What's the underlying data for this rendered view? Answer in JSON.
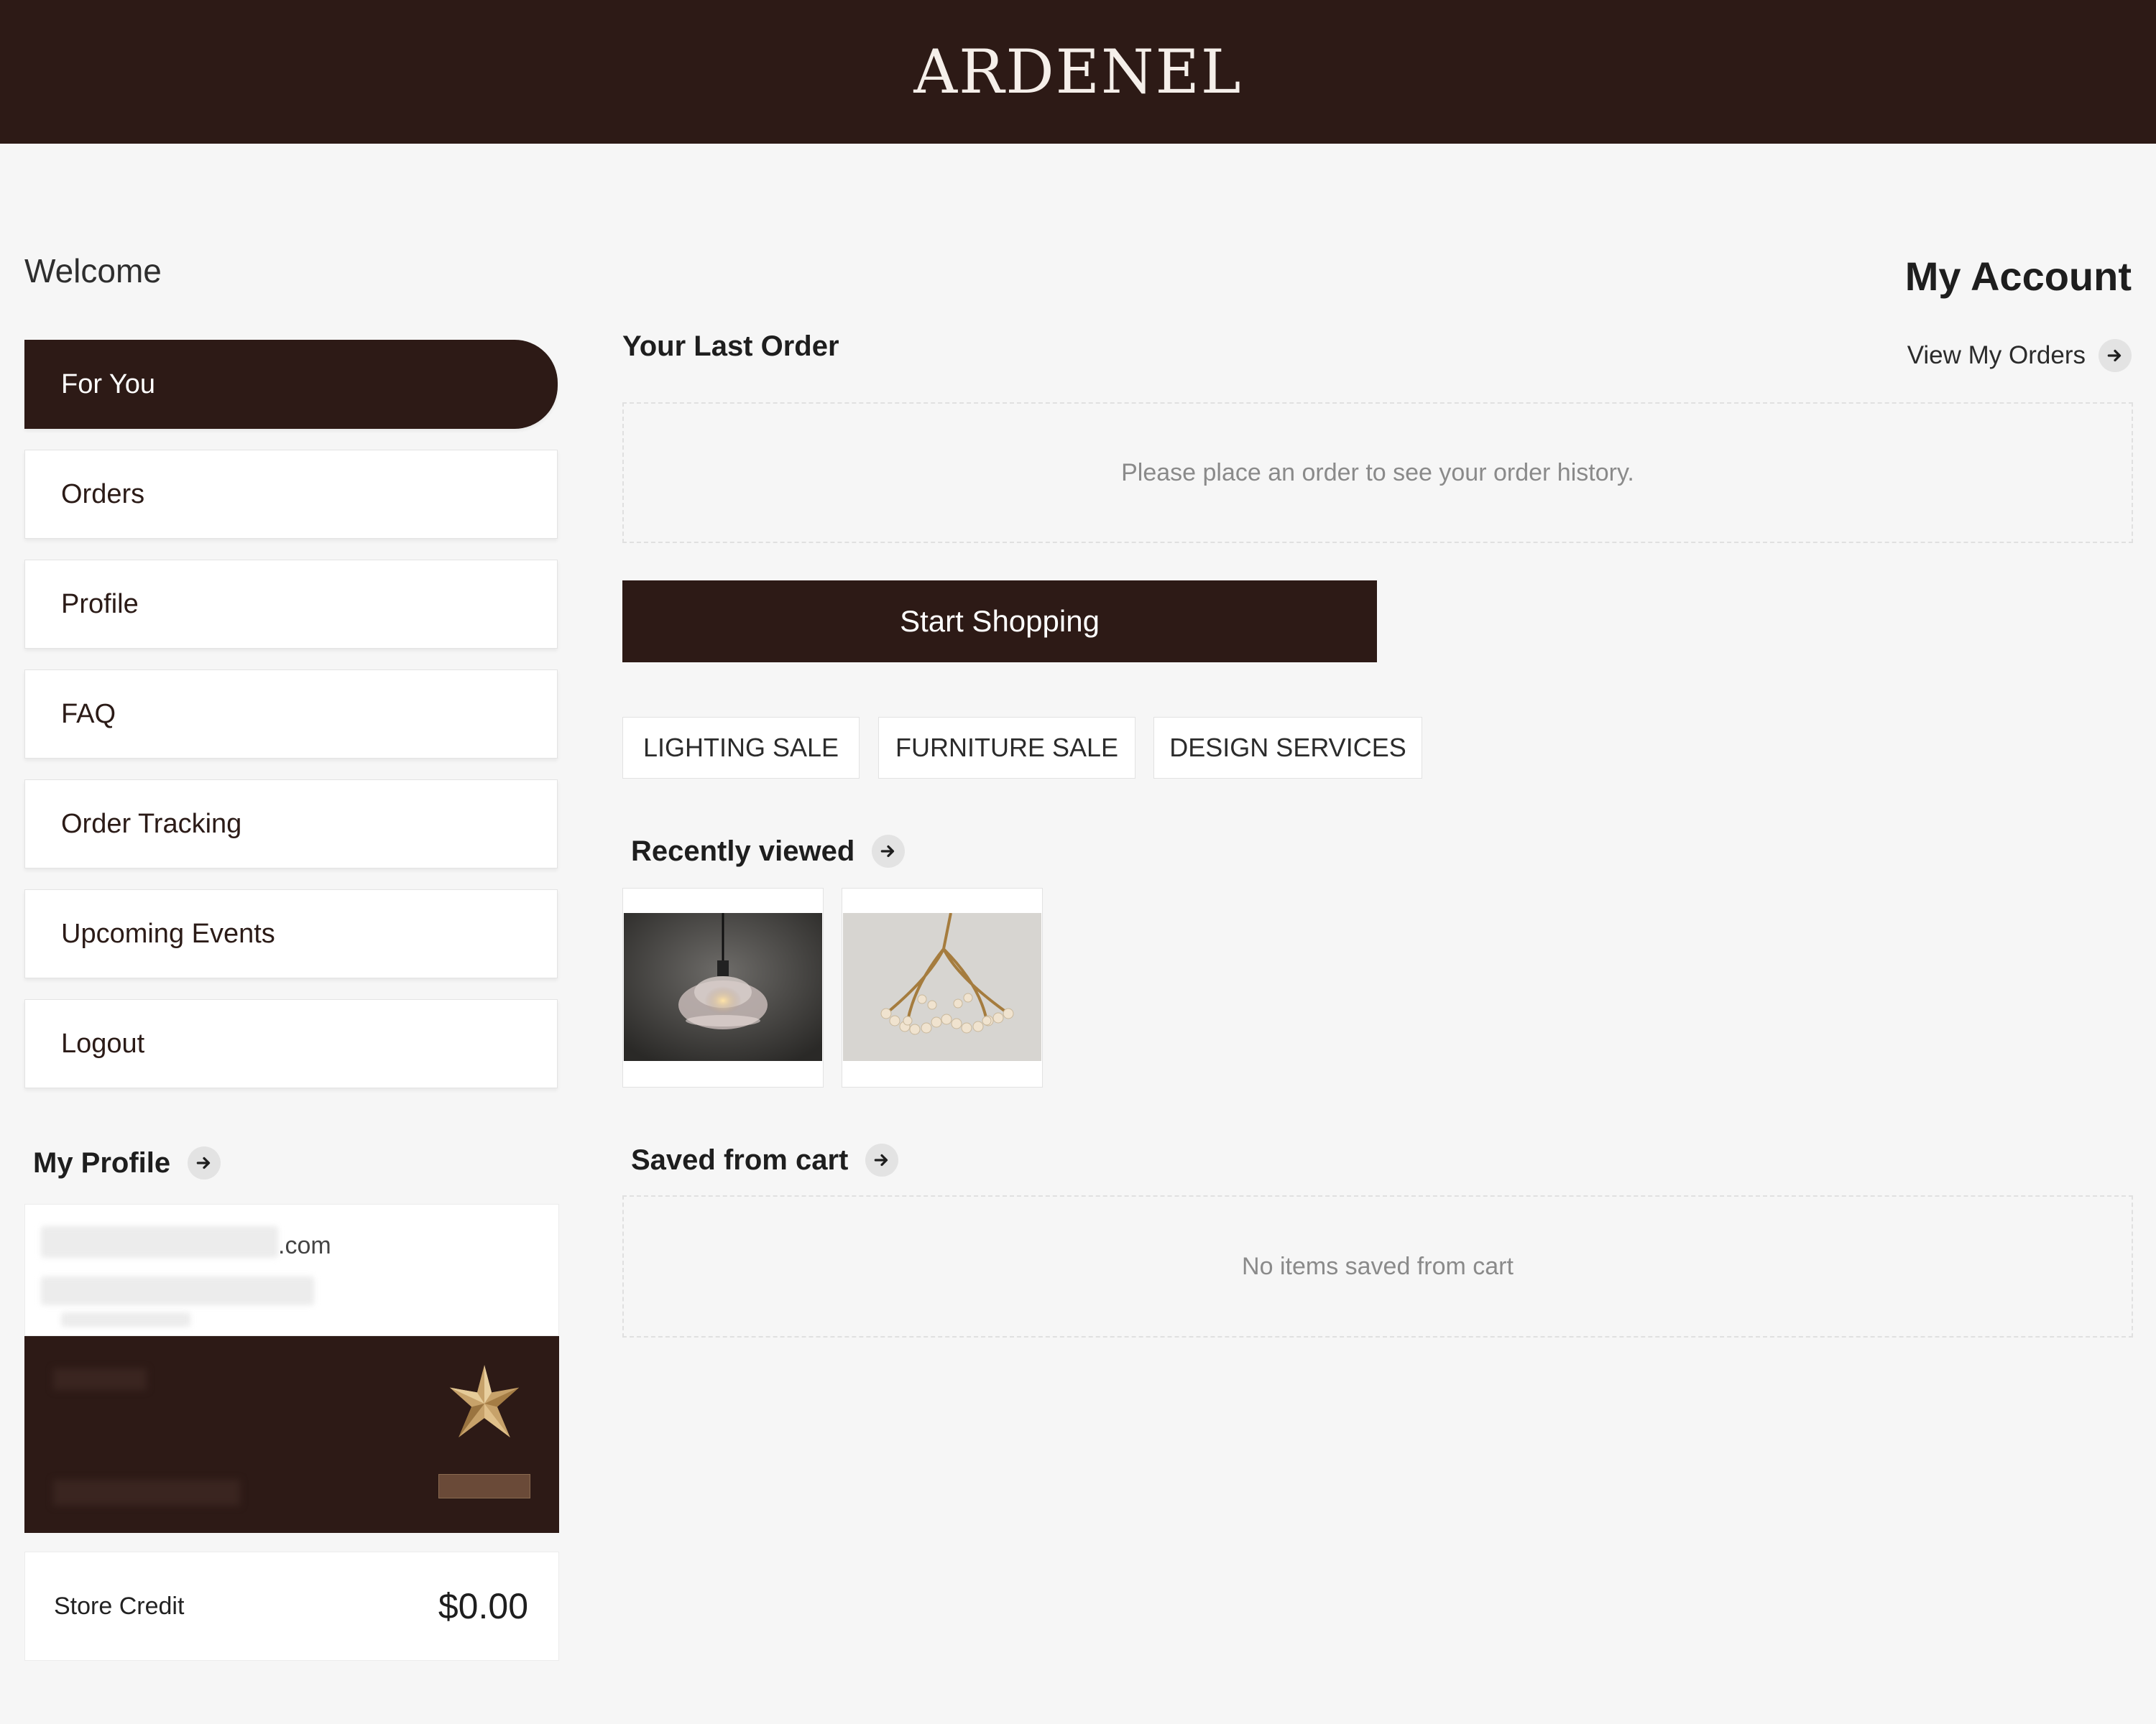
{
  "brand": {
    "logo_text": "ARDENEL",
    "primary_color": "#2d1a16"
  },
  "sidebar": {
    "welcome": "Welcome",
    "items": [
      {
        "label": "For You",
        "active": true
      },
      {
        "label": "Orders"
      },
      {
        "label": "Profile"
      },
      {
        "label": "FAQ"
      },
      {
        "label": "Order Tracking"
      },
      {
        "label": "Upcoming Events"
      },
      {
        "label": "Logout"
      }
    ],
    "my_profile_title": "My Profile",
    "email_suffix": ".com",
    "store_credit_label": "Store Credit",
    "store_credit_value": "$0.00"
  },
  "main": {
    "page_title": "My Account",
    "last_order_title": "Your Last Order",
    "view_orders_label": "View My Orders",
    "empty_order_text": "Please place an order to see your order history.",
    "start_shopping_label": "Start Shopping",
    "chips": [
      "LIGHTING SALE",
      "FURNITURE SALE",
      "DESIGN SERVICES"
    ],
    "recently_viewed_title": "Recently viewed",
    "recently_viewed_items": [
      "glass-pendant-lamp",
      "beaded-chandelier"
    ],
    "saved_title": "Saved from cart",
    "saved_empty_text": "No items saved from cart"
  }
}
